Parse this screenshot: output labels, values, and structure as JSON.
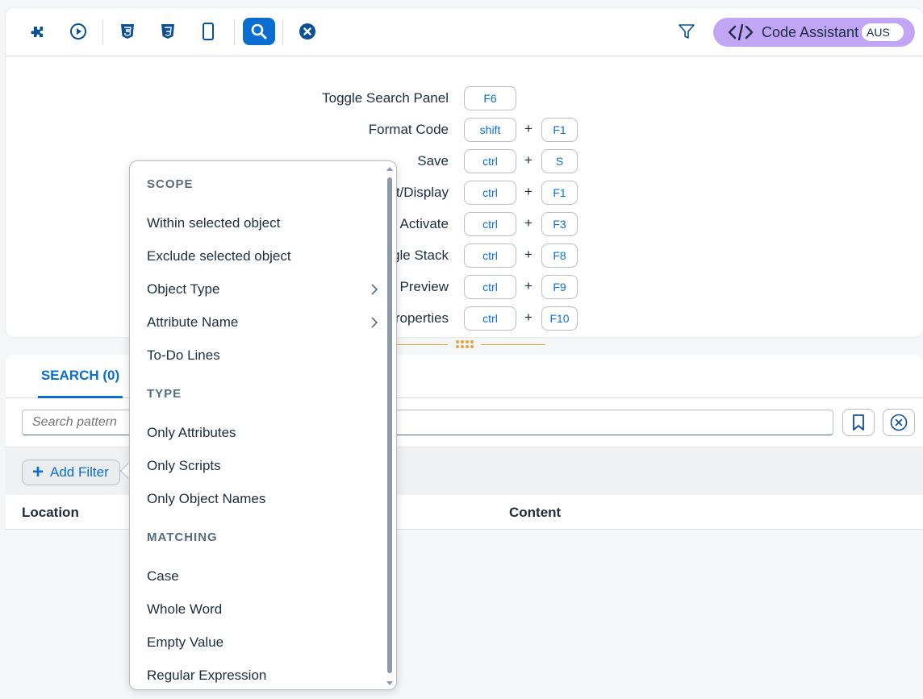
{
  "toolbar": {
    "buttons": [
      {
        "icon": "puzzle-icon"
      },
      {
        "icon": "play-icon"
      },
      {
        "icon": "html5-icon"
      },
      {
        "icon": "css3-icon"
      },
      {
        "icon": "mobile-icon"
      },
      {
        "icon": "search-icon"
      },
      {
        "icon": "close-circle-icon"
      }
    ],
    "filter_icon": "filter-icon",
    "assistant": {
      "label": "Code Assistant",
      "toggle": "AUS"
    }
  },
  "shortcuts": [
    {
      "label": "Toggle Search Panel",
      "keys": [
        "F6"
      ]
    },
    {
      "label": "Format Code",
      "keys": [
        "shift",
        "F1"
      ]
    },
    {
      "label": "Save",
      "keys": [
        "ctrl",
        "S"
      ]
    },
    {
      "label": "t/Display",
      "keys": [
        "ctrl",
        "F1"
      ]
    },
    {
      "label": "Activate",
      "keys": [
        "ctrl",
        "F3"
      ]
    },
    {
      "label": "gle Stack",
      "keys": [
        "ctrl",
        "F8"
      ]
    },
    {
      "label": "Preview",
      "keys": [
        "ctrl",
        "F9"
      ]
    },
    {
      "label": "roperties",
      "keys": [
        "ctrl",
        "F10"
      ]
    },
    {
      "label": "",
      "keys": [
        "",
        ""
      ]
    }
  ],
  "bottom": {
    "tab_label": "SEARCH (0)",
    "search_placeholder": "Search pattern",
    "add_filter_label": "Add Filter",
    "columns": {
      "location": "Location",
      "content": "Content"
    }
  },
  "menu": {
    "groups": [
      {
        "title": "SCOPE",
        "items": [
          {
            "label": "Within selected object",
            "submenu": false
          },
          {
            "label": "Exclude selected object",
            "submenu": false
          },
          {
            "label": "Object Type",
            "submenu": true
          },
          {
            "label": "Attribute Name",
            "submenu": true
          },
          {
            "label": "To-Do Lines",
            "submenu": false
          }
        ]
      },
      {
        "title": "TYPE",
        "items": [
          {
            "label": "Only Attributes",
            "submenu": false
          },
          {
            "label": "Only Scripts",
            "submenu": false
          },
          {
            "label": "Only Object Names",
            "submenu": false
          }
        ]
      },
      {
        "title": "MATCHING",
        "items": [
          {
            "label": "Case",
            "submenu": false
          },
          {
            "label": "Whole Word",
            "submenu": false
          },
          {
            "label": "Empty Value",
            "submenu": false
          },
          {
            "label": "Regular Expression",
            "submenu": false
          }
        ]
      }
    ]
  },
  "colors": {
    "accent": "#0a6ed1",
    "assistant_bg": "#c1a6f7",
    "splitter": "#e8a33d"
  }
}
